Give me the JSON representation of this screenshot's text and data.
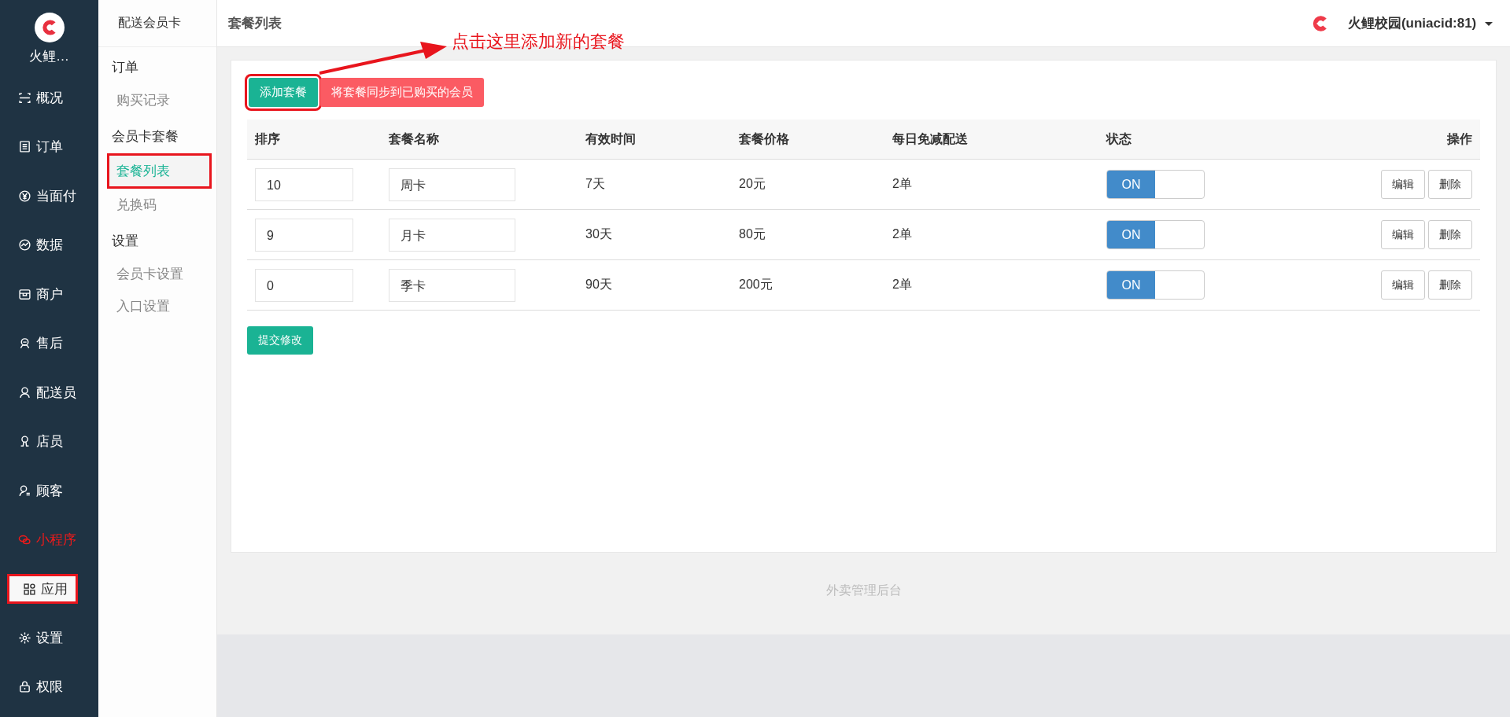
{
  "brand": {
    "name": "火鲤…"
  },
  "nav": [
    {
      "label": "概况",
      "selected": false,
      "highlighted": false,
      "annotated": false
    },
    {
      "label": "订单",
      "selected": false,
      "highlighted": false,
      "annotated": false
    },
    {
      "label": "当面付",
      "selected": false,
      "highlighted": false,
      "annotated": false
    },
    {
      "label": "数据",
      "selected": false,
      "highlighted": false,
      "annotated": false
    },
    {
      "label": "商户",
      "selected": false,
      "highlighted": false,
      "annotated": false
    },
    {
      "label": "售后",
      "selected": false,
      "highlighted": false,
      "annotated": false
    },
    {
      "label": "配送员",
      "selected": false,
      "highlighted": false,
      "annotated": false
    },
    {
      "label": "店员",
      "selected": false,
      "highlighted": false,
      "annotated": false
    },
    {
      "label": "顾客",
      "selected": false,
      "highlighted": false,
      "annotated": false
    },
    {
      "label": "小程序",
      "selected": false,
      "highlighted": true,
      "annotated": false
    },
    {
      "label": "应用",
      "selected": true,
      "highlighted": false,
      "annotated": true
    },
    {
      "label": "设置",
      "selected": false,
      "highlighted": false,
      "annotated": false
    },
    {
      "label": "权限",
      "selected": false,
      "highlighted": false,
      "annotated": false
    }
  ],
  "submenu": {
    "title": "配送会员卡",
    "groups": [
      {
        "title": "订单",
        "items": [
          {
            "label": "购买记录",
            "selected": false,
            "annotated": false
          }
        ]
      },
      {
        "title": "会员卡套餐",
        "items": [
          {
            "label": "套餐列表",
            "selected": true,
            "annotated": true
          },
          {
            "label": "兑换码",
            "selected": false,
            "annotated": false
          }
        ]
      },
      {
        "title": "设置",
        "items": [
          {
            "label": "会员卡设置",
            "selected": false,
            "annotated": false
          },
          {
            "label": "入口设置",
            "selected": false,
            "annotated": false
          }
        ]
      }
    ]
  },
  "header": {
    "title": "套餐列表",
    "account": "火鲤校园(uniacid:81)"
  },
  "annotation": {
    "text": "点击这里添加新的套餐"
  },
  "buttons": [
    {
      "label": "添加套餐",
      "kind": "primary",
      "annotated": true
    },
    {
      "label": "将套餐同步到已购买的会员",
      "kind": "danger",
      "annotated": false
    }
  ],
  "table": {
    "columns": [
      "排序",
      "套餐名称",
      "有效时间",
      "套餐价格",
      "每日免减配送",
      "状态",
      "操作"
    ],
    "rows": [
      {
        "order": "10",
        "name": "周卡",
        "duration": "7天",
        "price": "20元",
        "daily": "2单",
        "status": {
          "on": true,
          "label": "ON"
        },
        "actions": [
          "编辑",
          "删除"
        ]
      },
      {
        "order": "9",
        "name": "月卡",
        "duration": "30天",
        "price": "80元",
        "daily": "2单",
        "status": {
          "on": true,
          "label": "ON"
        },
        "actions": [
          "编辑",
          "删除"
        ]
      },
      {
        "order": "0",
        "name": "季卡",
        "duration": "90天",
        "price": "200元",
        "daily": "2单",
        "status": {
          "on": true,
          "label": "ON"
        },
        "actions": [
          "编辑",
          "删除"
        ]
      }
    ]
  },
  "submit": "提交修改",
  "footer": "外卖管理后台"
}
